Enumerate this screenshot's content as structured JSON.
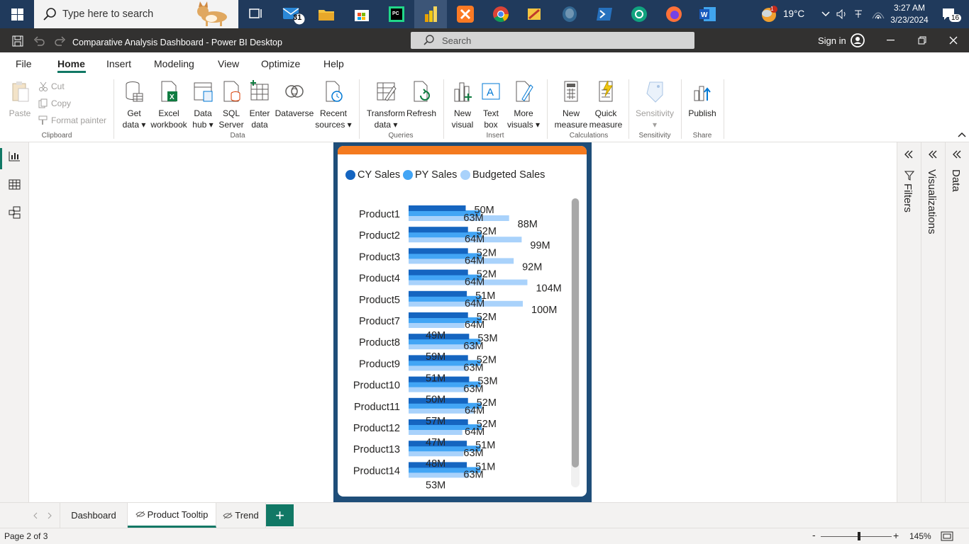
{
  "taskbar": {
    "search_placeholder": "Type here to search",
    "mail_badge": "31",
    "weather": "19°C",
    "weather_badge": "1",
    "time": "3:27 AM",
    "date": "3/23/2024",
    "notif_count": "16"
  },
  "window": {
    "title": "Comparative Analysis Dashboard - Power BI Desktop",
    "search_placeholder": "Search",
    "sign_in": "Sign in"
  },
  "menu": [
    "File",
    "Home",
    "Insert",
    "Modeling",
    "View",
    "Optimize",
    "Help"
  ],
  "ribbon": {
    "clipboard": {
      "paste": "Paste",
      "cut": "Cut",
      "copy": "Copy",
      "format_painter": "Format painter",
      "group": "Clipboard"
    },
    "data": {
      "get_data": [
        "Get",
        "data"
      ],
      "excel": [
        "Excel",
        "workbook"
      ],
      "data_hub": [
        "Data",
        "hub"
      ],
      "sql": [
        "SQL",
        "Server"
      ],
      "enter": [
        "Enter",
        "data"
      ],
      "dataverse": "Dataverse",
      "recent": [
        "Recent",
        "sources"
      ],
      "group": "Data"
    },
    "queries": {
      "transform": [
        "Transform",
        "data"
      ],
      "refresh": "Refresh",
      "group": "Queries"
    },
    "insert": {
      "new_visual": [
        "New",
        "visual"
      ],
      "text_box": [
        "Text",
        "box"
      ],
      "more_visuals": [
        "More",
        "visuals"
      ],
      "group": "Insert"
    },
    "calculations": {
      "new_measure": [
        "New",
        "measure"
      ],
      "quick_measure": [
        "Quick",
        "measure"
      ],
      "group": "Calculations"
    },
    "sensitivity": {
      "label": "Sensitivity",
      "group": "Sensitivity"
    },
    "share": {
      "publish": "Publish",
      "group": "Share"
    }
  },
  "panes": {
    "filters": "Filters",
    "visualizations": "Visualizations",
    "data": "Data"
  },
  "legend": [
    {
      "name": "CY Sales",
      "color": "#1565c0"
    },
    {
      "name": "PY Sales",
      "color": "#42a5f5"
    },
    {
      "name": "Budgeted Sales",
      "color": "#a9d2fb"
    }
  ],
  "chart_data": {
    "type": "bar",
    "orientation": "horizontal",
    "categories": [
      "Product1",
      "Product2",
      "Product3",
      "Product4",
      "Product5",
      "Product7",
      "Product8",
      "Product9",
      "Product10",
      "Product11",
      "Product12",
      "Product13",
      "Product14"
    ],
    "series": [
      {
        "name": "CY Sales",
        "color": "#1565c0",
        "values": [
          50,
          52,
          52,
          52,
          51,
          52,
          53,
          52,
          53,
          52,
          52,
          51,
          51
        ],
        "labels": [
          "50M",
          "52M",
          "52M",
          "52M",
          "51M",
          "52M",
          "53M",
          "52M",
          "53M",
          "52M",
          "52M",
          "51M",
          "51M"
        ]
      },
      {
        "name": "PY Sales",
        "color": "#42a5f5",
        "values": [
          63,
          64,
          64,
          64,
          64,
          64,
          63,
          63,
          63,
          64,
          64,
          63,
          63
        ],
        "labels": [
          "63M",
          "64M",
          "64M",
          "64M",
          "64M",
          "64M",
          "63M",
          "63M",
          "63M",
          "64M",
          "64M",
          "63M",
          "63M"
        ]
      },
      {
        "name": "Budgeted Sales",
        "color": "#a9d2fb",
        "values": [
          88,
          99,
          92,
          104,
          100,
          49,
          59,
          51,
          50,
          57,
          47,
          48,
          53
        ],
        "labels": [
          "88M",
          "99M",
          "92M",
          "104M",
          "100M",
          "49M",
          "59M",
          "51M",
          "50M",
          "57M",
          "47M",
          "48M",
          "53M"
        ]
      }
    ],
    "legend_position": "top-left"
  },
  "tabs": [
    "Dashboard",
    "Product Tooltip",
    "Trend"
  ],
  "status": {
    "page": "Page 2 of 3",
    "zoom": "145%"
  }
}
